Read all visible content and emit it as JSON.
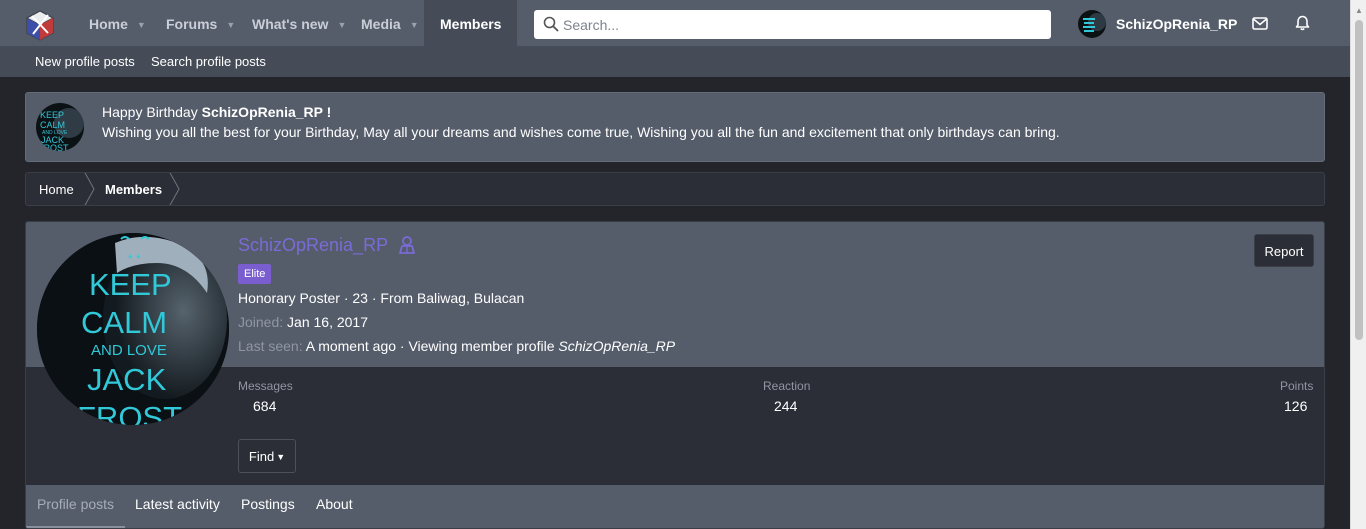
{
  "nav": {
    "logo_icon": "site-logo-cube",
    "tabs": [
      {
        "label": "Home",
        "has_menu": true
      },
      {
        "label": "Forums",
        "has_menu": true
      },
      {
        "label": "What's new",
        "has_menu": true
      },
      {
        "label": "Media",
        "has_menu": true
      },
      {
        "label": "Members",
        "active": true
      }
    ],
    "search_placeholder": "Search...",
    "user_name": "SchizOpRenia_RP",
    "icons": [
      "envelope-icon",
      "bell-icon"
    ]
  },
  "subnav": {
    "items": [
      "New profile posts",
      "Search profile posts"
    ]
  },
  "notice": {
    "prefix": "Happy Birthday ",
    "name": "SchizOpRenia_RP",
    "suffix": " !",
    "message": "Wishing you all the best for your Birthday, May all your dreams and wishes come true, Wishing you all the fun and excitement that only birthdays can bring."
  },
  "breadcrumb": [
    "Home",
    "Members"
  ],
  "profile": {
    "avatar_text": [
      "KEEP",
      "CALM",
      "AND LOVE",
      "JACK",
      "FROST"
    ],
    "username": "SchizOpRenia_RP",
    "username_color": "#7a6bd6",
    "badge": "Elite",
    "badge_color": "#7a5ed0",
    "title_line": "Honorary Poster · 23 · From Baliwag, Bulacan",
    "joined_label": "Joined:",
    "joined_value": "Jan 16, 2017",
    "lastseen_label": "Last seen:",
    "lastseen_value": "A moment ago · Viewing member profile ",
    "lastseen_target": "SchizOpRenia_RP",
    "report_label": "Report",
    "stats": [
      {
        "label": "Messages",
        "value": "684"
      },
      {
        "label": "Reaction",
        "value": "244"
      },
      {
        "label": "Points",
        "value": "126"
      }
    ],
    "find_label": "Find",
    "tabs": [
      "Profile posts",
      "Latest activity",
      "Postings",
      "About"
    ],
    "active_tab": "Profile posts"
  }
}
